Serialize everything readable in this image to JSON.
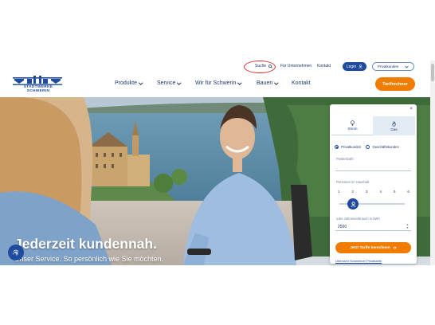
{
  "topbar": {
    "search_label": "Suche",
    "links": [
      "Für Unternehmen",
      "Kontakt"
    ],
    "login_label": "Login",
    "segment_select_value": "Privatkunden"
  },
  "logo": {
    "text": "STADTWERKE SCHWERIN"
  },
  "nav": {
    "items": [
      {
        "label": "Produkte",
        "has_dropdown": true
      },
      {
        "label": "Service",
        "has_dropdown": true
      },
      {
        "label": "Wir für Schwerin",
        "has_dropdown": true
      },
      {
        "label": "Bauen",
        "has_dropdown": true
      },
      {
        "label": "Kontakt",
        "has_dropdown": false
      }
    ],
    "cta_label": "Tarifrechner"
  },
  "hero": {
    "headline": "Jederzeit kundennah.",
    "subline": "Unser Service. So persönlich wie Sie möchten."
  },
  "widget": {
    "close_label": "×",
    "tabs": [
      {
        "label": "Strom",
        "icon": "lightbulb-icon"
      },
      {
        "label": "Gas",
        "icon": "flame-icon",
        "active": true
      }
    ],
    "customer_types": [
      {
        "label": "Privatkunden",
        "selected": true
      },
      {
        "label": "Geschäftskunden",
        "selected": false
      }
    ],
    "postcode_label": "Postleitzahl",
    "postcode_value": "",
    "persons_label": "Personen im Haushalt",
    "persons_options": [
      "1",
      "2",
      "3",
      "4",
      "5",
      "6"
    ],
    "persons_selected": "1",
    "consumption_label": "oder Jahresverbrauch in kWh",
    "consumption_value": "2500",
    "calc_button_label": "Jetzt Tarife berechnen",
    "footer_link": "Übersicht Schweriner Privattarife"
  },
  "colors": {
    "brand_blue": "#1e4b9e",
    "accent_orange": "#f07d00",
    "text_navy": "#1e3a6e"
  }
}
